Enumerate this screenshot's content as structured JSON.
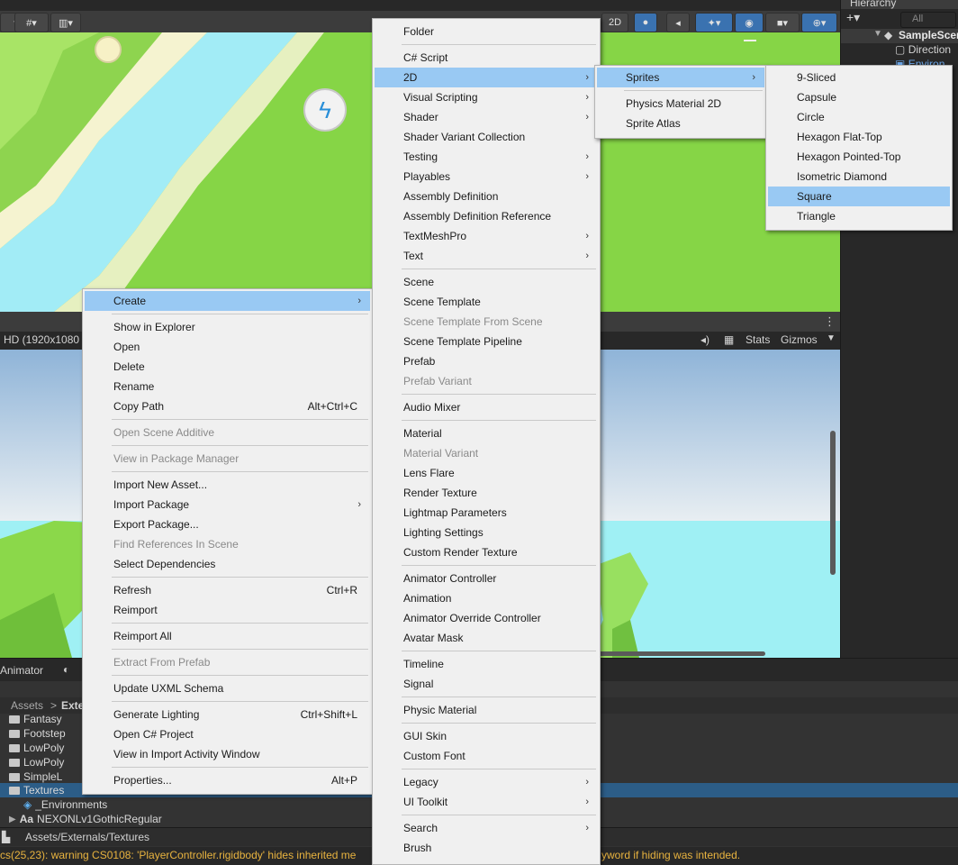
{
  "scene_toolbar": {
    "mode_2d_label": "2D"
  },
  "hierarchy": {
    "title": "Hierarchy",
    "search_placeholder": "All",
    "items": [
      "SampleScene",
      "Direction",
      "Environ"
    ]
  },
  "game_view": {
    "resolution_label": "HD (1920x1080",
    "stats_label": "Stats",
    "gizmos_label": "Gizmos"
  },
  "bottom": {
    "animator_tab": "Animator",
    "breadcrumb": [
      "Assets",
      "Exte"
    ],
    "folders": [
      "Fantasy",
      "Footstep",
      "LowPoly",
      "LowPoly",
      "SimpleL",
      "Textures"
    ],
    "assets": [
      "_Environments",
      "NEXONLv1GothicRegular"
    ],
    "path": "Assets/Externals/Textures",
    "status_left": "cs(25,23): warning CS0108: 'PlayerController.rigidbody' hides inherited me",
    "status_right": "yword if hiding was intended."
  },
  "context_menu": {
    "items": [
      {
        "label": "Create",
        "submenu": true,
        "highlighted": true
      },
      {
        "separator": true
      },
      {
        "label": "Show in Explorer"
      },
      {
        "label": "Open"
      },
      {
        "label": "Delete"
      },
      {
        "label": "Rename"
      },
      {
        "label": "Copy Path",
        "shortcut": "Alt+Ctrl+C"
      },
      {
        "separator": true
      },
      {
        "label": "Open Scene Additive",
        "disabled": true
      },
      {
        "separator": true
      },
      {
        "label": "View in Package Manager",
        "disabled": true
      },
      {
        "separator": true
      },
      {
        "label": "Import New Asset..."
      },
      {
        "label": "Import Package",
        "submenu": true
      },
      {
        "label": "Export Package..."
      },
      {
        "label": "Find References In Scene",
        "disabled": true
      },
      {
        "label": "Select Dependencies"
      },
      {
        "separator": true
      },
      {
        "label": "Refresh",
        "shortcut": "Ctrl+R"
      },
      {
        "label": "Reimport"
      },
      {
        "separator": true
      },
      {
        "label": "Reimport All"
      },
      {
        "separator": true
      },
      {
        "label": "Extract From Prefab",
        "disabled": true
      },
      {
        "separator": true
      },
      {
        "label": "Update UXML Schema"
      },
      {
        "separator": true
      },
      {
        "label": "Generate Lighting",
        "shortcut": "Ctrl+Shift+L"
      },
      {
        "label": "Open C# Project"
      },
      {
        "label": "View in Import Activity Window"
      },
      {
        "separator": true
      },
      {
        "label": "Properties...",
        "shortcut": "Alt+P"
      }
    ]
  },
  "create_menu": {
    "items": [
      {
        "label": "Folder"
      },
      {
        "separator": true
      },
      {
        "label": "C# Script"
      },
      {
        "label": "2D",
        "submenu": true,
        "highlighted": true
      },
      {
        "label": "Visual Scripting",
        "submenu": true
      },
      {
        "label": "Shader",
        "submenu": true
      },
      {
        "label": "Shader Variant Collection"
      },
      {
        "label": "Testing",
        "submenu": true
      },
      {
        "label": "Playables",
        "submenu": true
      },
      {
        "label": "Assembly Definition"
      },
      {
        "label": "Assembly Definition Reference"
      },
      {
        "label": "TextMeshPro",
        "submenu": true
      },
      {
        "label": "Text",
        "submenu": true
      },
      {
        "separator": true
      },
      {
        "label": "Scene"
      },
      {
        "label": "Scene Template"
      },
      {
        "label": "Scene Template From Scene",
        "disabled": true
      },
      {
        "label": "Scene Template Pipeline"
      },
      {
        "label": "Prefab"
      },
      {
        "label": "Prefab Variant",
        "disabled": true
      },
      {
        "separator": true
      },
      {
        "label": "Audio Mixer"
      },
      {
        "separator": true
      },
      {
        "label": "Material"
      },
      {
        "label": "Material Variant",
        "disabled": true
      },
      {
        "label": "Lens Flare"
      },
      {
        "label": "Render Texture"
      },
      {
        "label": "Lightmap Parameters"
      },
      {
        "label": "Lighting Settings"
      },
      {
        "label": "Custom Render Texture"
      },
      {
        "separator": true
      },
      {
        "label": "Animator Controller"
      },
      {
        "label": "Animation"
      },
      {
        "label": "Animator Override Controller"
      },
      {
        "label": "Avatar Mask"
      },
      {
        "separator": true
      },
      {
        "label": "Timeline"
      },
      {
        "label": "Signal"
      },
      {
        "separator": true
      },
      {
        "label": "Physic Material"
      },
      {
        "separator": true
      },
      {
        "label": "GUI Skin"
      },
      {
        "label": "Custom Font"
      },
      {
        "separator": true
      },
      {
        "label": "Legacy",
        "submenu": true
      },
      {
        "label": "UI Toolkit",
        "submenu": true
      },
      {
        "separator": true
      },
      {
        "label": "Search",
        "submenu": true
      },
      {
        "label": "Brush"
      }
    ]
  },
  "menu_2d": {
    "items": [
      {
        "label": "Sprites",
        "submenu": true,
        "highlighted": true
      },
      {
        "separator": true
      },
      {
        "label": "Physics Material 2D"
      },
      {
        "label": "Sprite Atlas"
      }
    ]
  },
  "sprites_menu": {
    "items": [
      {
        "label": "9-Sliced"
      },
      {
        "label": "Capsule"
      },
      {
        "label": "Circle"
      },
      {
        "label": "Hexagon Flat-Top"
      },
      {
        "label": "Hexagon Pointed-Top"
      },
      {
        "label": "Isometric Diamond"
      },
      {
        "label": "Square",
        "highlighted": true
      },
      {
        "label": "Triangle"
      }
    ]
  }
}
